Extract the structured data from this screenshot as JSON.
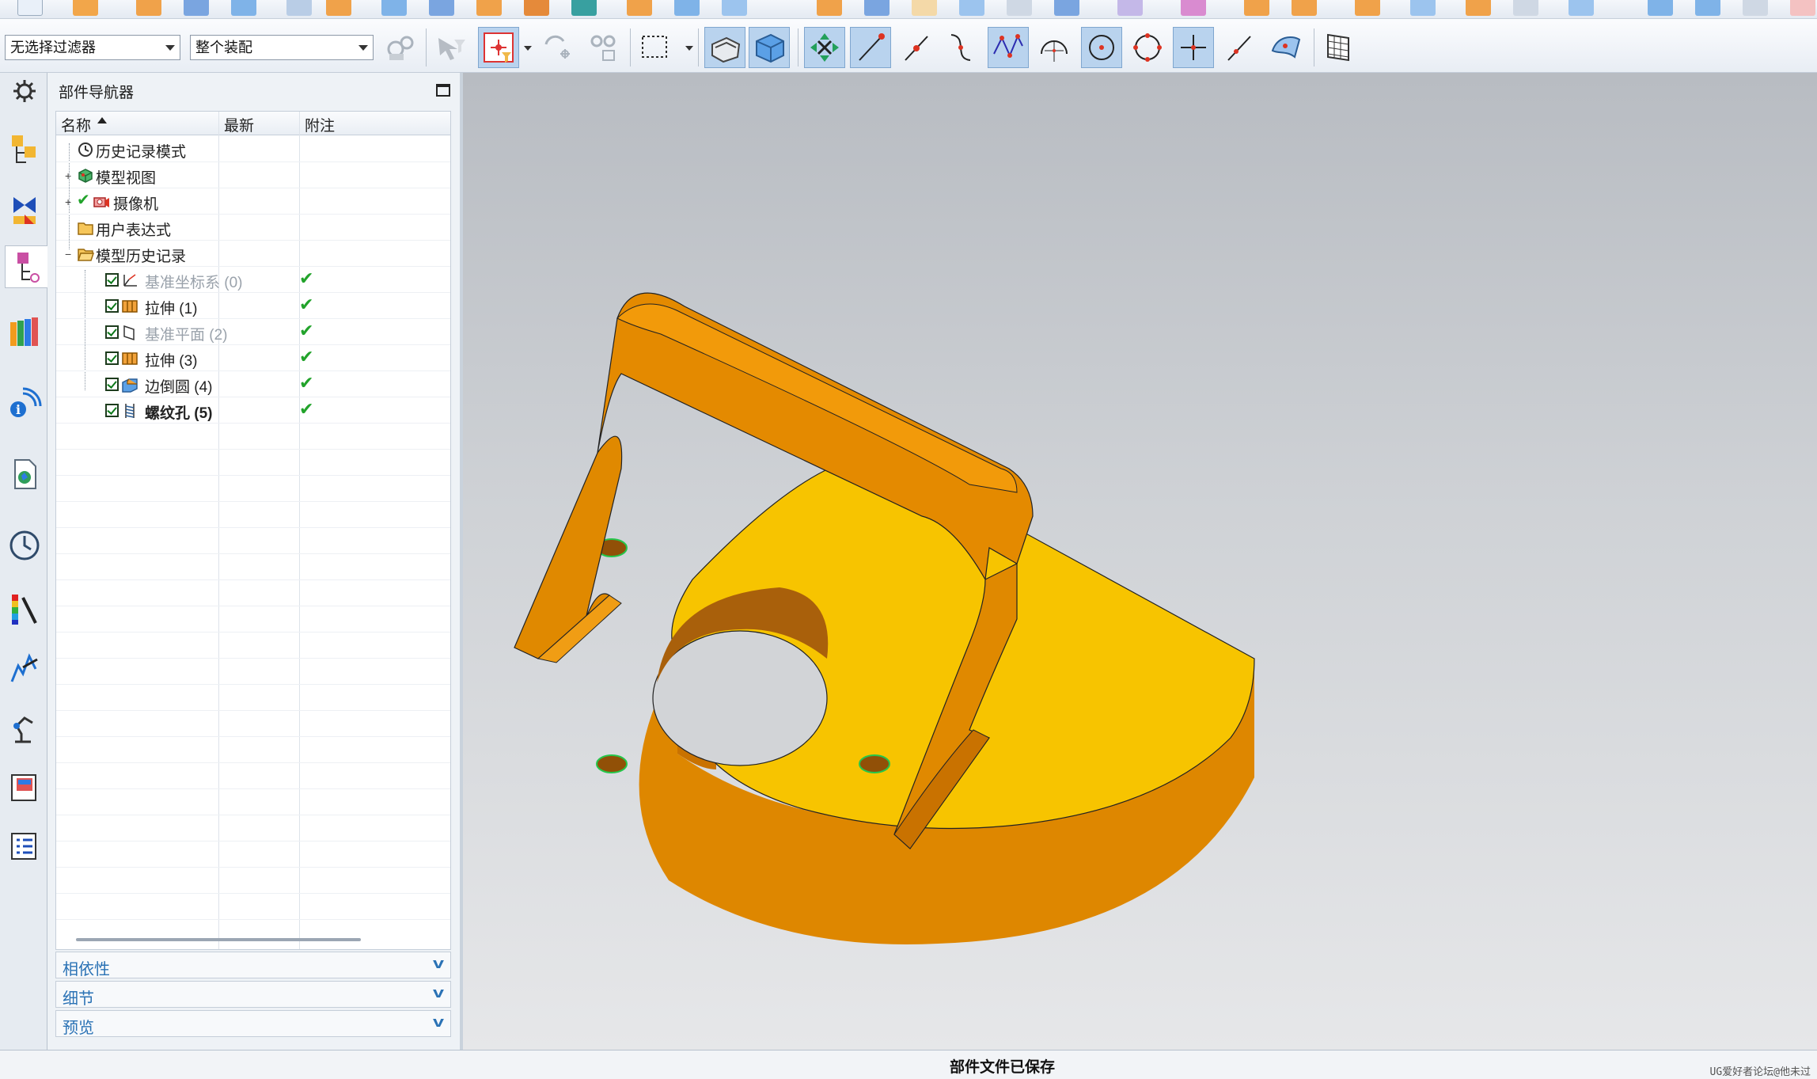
{
  "toolbar": {
    "filter_select": "无选择过滤器",
    "scope_select": "整个装配"
  },
  "navigator": {
    "title": "部件导航器",
    "columns": {
      "name": "名称",
      "latest": "最新",
      "note": "附注"
    },
    "nodes": [
      {
        "label": "历史记录模式",
        "icon": "clock-icon"
      },
      {
        "label": "模型视图",
        "icon": "model-views-icon"
      },
      {
        "label": "摄像机",
        "icon": "camera-icon"
      },
      {
        "label": "用户表达式",
        "icon": "folder-icon"
      },
      {
        "label": "模型历史记录",
        "icon": "folder-open-icon"
      }
    ],
    "features": [
      {
        "label": "基准坐标系 (0)",
        "icon": "datum-csys-icon",
        "latest": "✔",
        "style": "gray"
      },
      {
        "label": "拉伸 (1)",
        "icon": "extrude-icon",
        "latest": "✔",
        "style": "normal"
      },
      {
        "label": "基准平面 (2)",
        "icon": "datum-plane-icon",
        "latest": "✔",
        "style": "gray"
      },
      {
        "label": "拉伸 (3)",
        "icon": "extrude-icon",
        "latest": "✔",
        "style": "normal"
      },
      {
        "label": "边倒圆 (4)",
        "icon": "edge-blend-icon",
        "latest": "✔",
        "style": "normal"
      },
      {
        "label": "螺纹孔 (5)",
        "icon": "threaded-hole-icon",
        "latest": "✔",
        "style": "bold"
      }
    ],
    "panels": [
      "相依性",
      "细节",
      "预览"
    ]
  },
  "status": {
    "message": "部件文件已保存",
    "watermark": "UG爱好者论坛@他未过"
  },
  "colors": {
    "model_top": "#f6c200",
    "model_side": "#e08a00",
    "model_dark": "#a85a00",
    "accent_link": "#2a72b5",
    "check_green": "#22a32b"
  }
}
